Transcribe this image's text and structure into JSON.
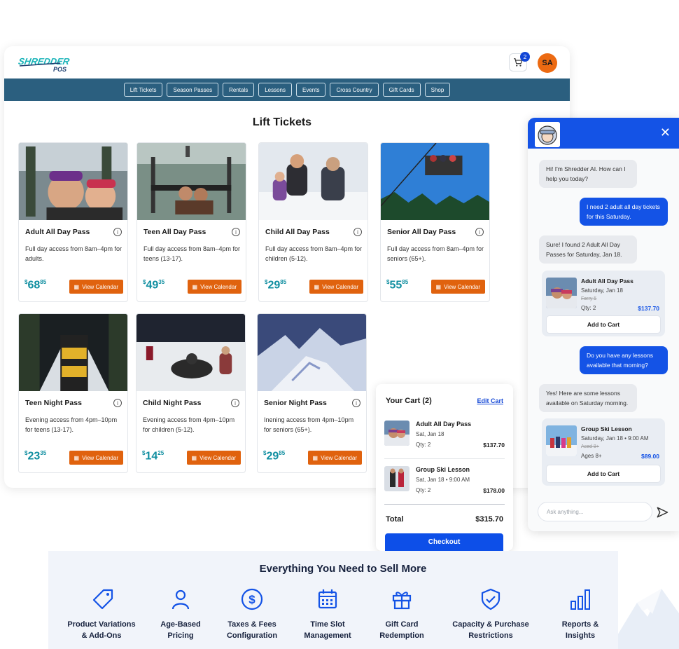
{
  "brand": {
    "logo_line1": "SHREDDER",
    "logo_line2": "POS"
  },
  "header": {
    "cart_count": "2",
    "avatar_initials": "SA"
  },
  "nav": [
    "Lift Tickets",
    "Season Passes",
    "Rentals",
    "Lessons",
    "Events",
    "Cross Country",
    "Gift Cards",
    "Shop"
  ],
  "page_title": "Lift Tickets",
  "products": [
    {
      "name": "Adult All Day Pass",
      "desc": "Full day access from 8am–4pm for adults.",
      "currency": "$",
      "dollars": "68",
      "cents": "85",
      "button": "View Calendar"
    },
    {
      "name": "Teen All Day Pass",
      "desc": "Full day access from 8am–4pm for teens (13-17).",
      "currency": "$",
      "dollars": "49",
      "cents": "35",
      "button": "View Calendar"
    },
    {
      "name": "Child All Day Pass",
      "desc": "Full day access from 8am–4pm for children (5-12).",
      "currency": "$",
      "dollars": "29",
      "cents": "85",
      "button": "View Calendar"
    },
    {
      "name": "Senior All Day Pass",
      "desc": "Full day access from 8am–4pm for seniors (65+).",
      "currency": "$",
      "dollars": "55",
      "cents": "85",
      "button": "View Calendar"
    },
    {
      "name": "Teen Night Pass",
      "desc": "Evening access from 4pm–10pm for teens (13-17).",
      "currency": "$",
      "dollars": "23",
      "cents": "35",
      "button": "View Calendar"
    },
    {
      "name": "Child Night Pass",
      "desc": "Evening access from 4pm–10pm for children (5-12).",
      "currency": "$",
      "dollars": "14",
      "cents": "25",
      "button": "View Calendar"
    },
    {
      "name": "Senior Night Pass",
      "desc": "Inening access from 4pm–10pm for seniors (65+).",
      "currency": "$",
      "dollars": "29",
      "cents": "85",
      "button": "View Calendar"
    }
  ],
  "cart": {
    "title": "Your Cart (2)",
    "edit": "Edit Cart",
    "items": [
      {
        "name": "Adult All Day Pass",
        "date": "Sat, Jan 18",
        "qty": "Qty: 2",
        "price": "$137.70"
      },
      {
        "name": "Group Ski Lesson",
        "date": "Sat, Jan 18 • 9:00 AM",
        "qty": "Qty: 2",
        "price": "$178.00"
      }
    ],
    "total_label": "Total",
    "total_value": "$315.70",
    "checkout": "Checkout"
  },
  "chat": {
    "msg1": "Hi! I'm Shredder AI. How can I help you today?",
    "msg2": "I need 2 adult all day tickets for this Saturday.",
    "msg3": "Sure! I found 2 Adult All Day Passes for Saturday, Jan 18.",
    "card1": {
      "name": "Adult All Day Pass",
      "date": "Saturday, Jan 18",
      "strike": "Ferry 5",
      "qty": "Qty: 2",
      "price": "$137.70",
      "button": "Add to Cart"
    },
    "msg4": "Do you have any lessons available that morning?",
    "msg5": "Yes! Here are some lessons available on Saturday morning.",
    "card2": {
      "name": "Group Ski Lesson",
      "date": "Saturday, Jan 18 • 9:00 AM",
      "strike": "Aced 8+",
      "qty": "Ages 8+",
      "price": "$89.00",
      "button": "Add to Cart"
    },
    "input_placeholder": "Ask anything..."
  },
  "features": {
    "title": "Everything You Need to Sell More",
    "items": [
      {
        "icon": "tag-icon",
        "line1": "Product Variations",
        "line2": "& Add-Ons"
      },
      {
        "icon": "user-icon",
        "line1": "Age-Based",
        "line2": "Pricing"
      },
      {
        "icon": "dollar-circle-icon",
        "line1": "Taxes & Fees",
        "line2": "Configuration"
      },
      {
        "icon": "calendar-icon",
        "line1": "Time Slot",
        "line2": "Management"
      },
      {
        "icon": "gift-icon",
        "line1": "Gift Card",
        "line2": "Redemption"
      },
      {
        "icon": "shield-check-icon",
        "line1": "Capacity & Purchase",
        "line2": "Restrictions"
      },
      {
        "icon": "bar-chart-icon",
        "line1": "Reports &",
        "line2": "Insights"
      }
    ]
  },
  "colors": {
    "accent": "#1453e6",
    "orange": "#e0620e",
    "nav": "#2b5f7f",
    "price": "#0f8ea0"
  }
}
